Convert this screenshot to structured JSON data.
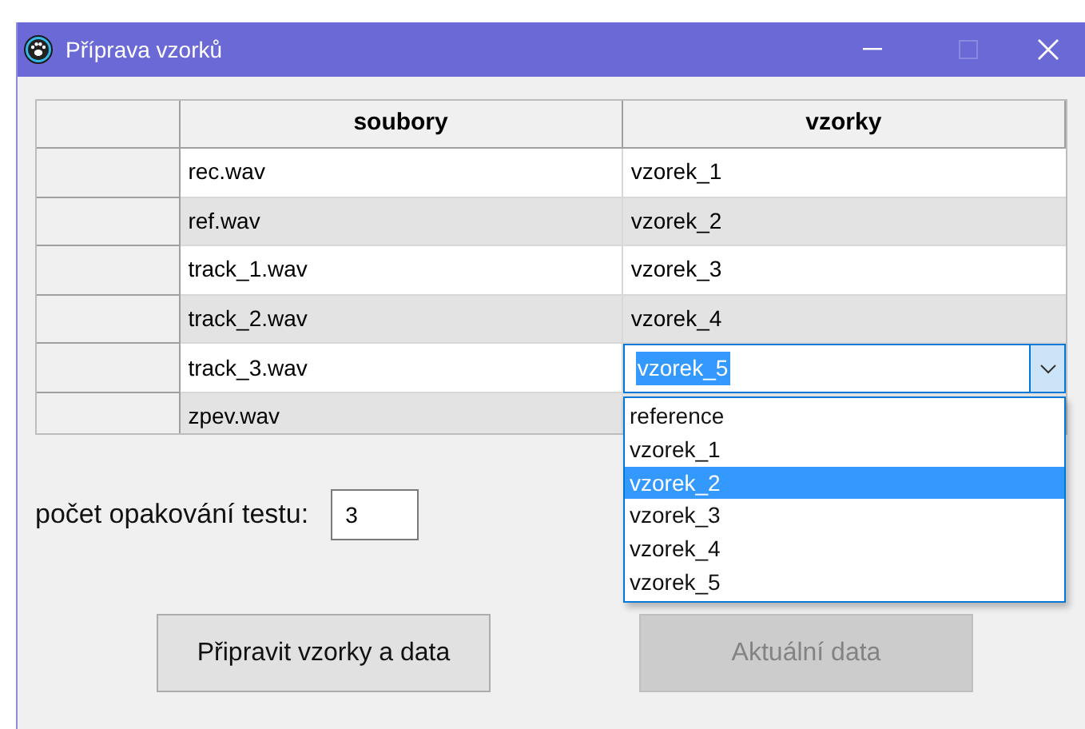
{
  "window": {
    "title": "Příprava vzorků"
  },
  "table": {
    "columns": [
      "soubory",
      "vzorky"
    ],
    "rows": [
      {
        "soubory": "rec.wav",
        "vzorky": "vzorek_1",
        "editing": false
      },
      {
        "soubory": "ref.wav",
        "vzorky": "vzorek_2",
        "editing": false
      },
      {
        "soubory": "track_1.wav",
        "vzorky": "vzorek_3",
        "editing": false
      },
      {
        "soubory": "track_2.wav",
        "vzorky": "vzorek_4",
        "editing": false
      },
      {
        "soubory": "track_3.wav",
        "vzorky": "vzorek_5",
        "editing": true
      },
      {
        "soubory": "zpev.wav",
        "editing": false
      }
    ]
  },
  "dropdown": {
    "options": [
      {
        "label": "reference",
        "selected": false
      },
      {
        "label": "vzorek_1",
        "selected": false
      },
      {
        "label": "vzorek_2",
        "selected": true
      },
      {
        "label": "vzorek_3",
        "selected": false
      },
      {
        "label": "vzorek_4",
        "selected": false
      },
      {
        "label": "vzorek_5",
        "selected": false
      }
    ]
  },
  "repeat": {
    "label": "počet opakování testu:",
    "value": "3"
  },
  "buttons": [
    {
      "label": "Připravit vzorky a data",
      "disabled": false
    },
    {
      "label": "Aktuální data",
      "disabled": true
    }
  ]
}
